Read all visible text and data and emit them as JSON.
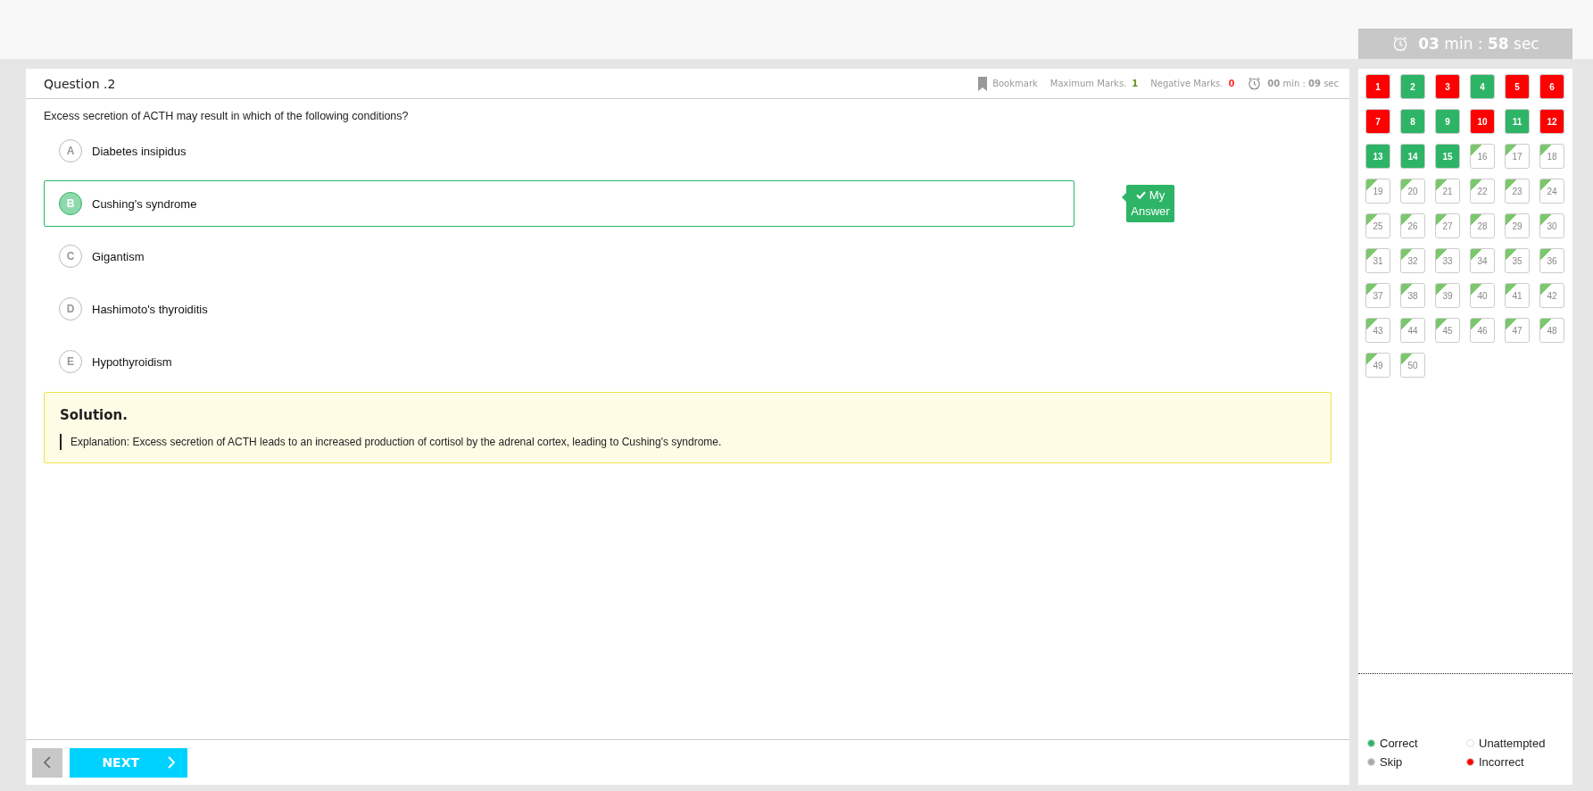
{
  "top_timer": "**03** min : **58** sec",
  "question": {
    "title": "Question .2",
    "bookmark": "Bookmark",
    "max_marks_label": "Maximum Marks.",
    "max_marks": "1",
    "negative_marks_label": "Negative Marks.",
    "negative_marks": "0",
    "timer": "**00** min : **09** sec",
    "text": "Excess secretion of ACTH may result in which of the following conditions?"
  },
  "options": [
    {
      "letter": "A",
      "text": "Diabetes insipidus",
      "selected": false
    },
    {
      "letter": "B",
      "text": "Cushing's syndrome",
      "selected": true,
      "answer_tag": "My Answer"
    },
    {
      "letter": "C",
      "text": "Gigantism",
      "selected": false
    },
    {
      "letter": "D",
      "text": "Hashimoto's thyroiditis",
      "selected": false
    },
    {
      "letter": "E",
      "text": "Hypothyroidism",
      "selected": false
    }
  ],
  "solution": {
    "title": "Solution.",
    "text": "Explanation: Excess secretion of ACTH leads to an increased production of cortisol by the adrenal cortex, leading to Cushing's syndrome."
  },
  "nav": {
    "next": "NEXT"
  },
  "palette": [
    {
      "number": "1",
      "kind": "incorrect"
    },
    {
      "number": "2",
      "kind": "correct"
    },
    {
      "number": "3",
      "kind": "incorrect"
    },
    {
      "number": "4",
      "kind": "correct"
    },
    {
      "number": "5",
      "kind": "incorrect"
    },
    {
      "number": "6",
      "kind": "incorrect"
    },
    {
      "number": "7",
      "kind": "incorrect"
    },
    {
      "number": "8",
      "kind": "correct"
    },
    {
      "number": "9",
      "kind": "correct"
    },
    {
      "number": "10",
      "kind": "incorrect"
    },
    {
      "number": "11",
      "kind": "correct"
    },
    {
      "number": "12",
      "kind": "incorrect"
    },
    {
      "number": "13",
      "kind": "correct"
    },
    {
      "number": "14",
      "kind": "correct"
    },
    {
      "number": "15",
      "kind": "correct"
    },
    {
      "number": "16",
      "kind": "unattempted"
    },
    {
      "number": "17",
      "kind": "unattempted"
    },
    {
      "number": "18",
      "kind": "unattempted"
    },
    {
      "number": "19",
      "kind": "unattempted"
    },
    {
      "number": "20",
      "kind": "unattempted"
    },
    {
      "number": "21",
      "kind": "unattempted"
    },
    {
      "number": "22",
      "kind": "unattempted"
    },
    {
      "number": "23",
      "kind": "unattempted"
    },
    {
      "number": "24",
      "kind": "unattempted"
    },
    {
      "number": "25",
      "kind": "unattempted"
    },
    {
      "number": "26",
      "kind": "unattempted"
    },
    {
      "number": "27",
      "kind": "unattempted"
    },
    {
      "number": "28",
      "kind": "unattempted"
    },
    {
      "number": "29",
      "kind": "unattempted"
    },
    {
      "number": "30",
      "kind": "unattempted"
    },
    {
      "number": "31",
      "kind": "unattempted"
    },
    {
      "number": "32",
      "kind": "unattempted"
    },
    {
      "number": "33",
      "kind": "unattempted"
    },
    {
      "number": "34",
      "kind": "unattempted"
    },
    {
      "number": "35",
      "kind": "unattempted"
    },
    {
      "number": "36",
      "kind": "unattempted"
    },
    {
      "number": "37",
      "kind": "unattempted"
    },
    {
      "number": "38",
      "kind": "unattempted"
    },
    {
      "number": "39",
      "kind": "unattempted"
    },
    {
      "number": "40",
      "kind": "unattempted"
    },
    {
      "number": "41",
      "kind": "unattempted"
    },
    {
      "number": "42",
      "kind": "unattempted"
    },
    {
      "number": "43",
      "kind": "unattempted"
    },
    {
      "number": "44",
      "kind": "unattempted"
    },
    {
      "number": "45",
      "kind": "unattempted"
    },
    {
      "number": "46",
      "kind": "unattempted"
    },
    {
      "number": "47",
      "kind": "unattempted"
    },
    {
      "number": "48",
      "kind": "unattempted"
    },
    {
      "number": "49",
      "kind": "unattempted"
    },
    {
      "number": "50",
      "kind": "unattempted"
    }
  ],
  "legend": [
    {
      "label": "Correct",
      "color": "#2eb466"
    },
    {
      "label": "Unattempted",
      "color": "#ffffff"
    },
    {
      "label": "Skip",
      "color": "#aaaaaa"
    },
    {
      "label": "Incorrect",
      "color": "#ff0000"
    }
  ]
}
